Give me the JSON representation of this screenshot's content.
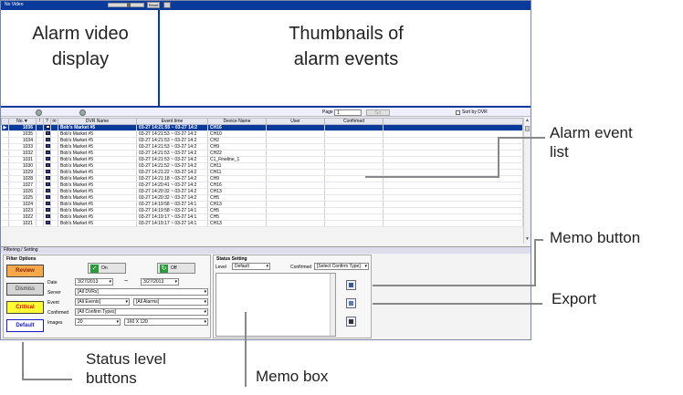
{
  "topbar": {
    "video_label": "No Video",
    "reset_label": "Reset"
  },
  "panes": {
    "video_label": [
      "Alarm video",
      "display"
    ],
    "thumb_label": [
      "Thumbnails of",
      "alarm events"
    ]
  },
  "listbar": {
    "page_label": "Page",
    "page_value": "1",
    "go_label": "Go",
    "sort_label": "Sort by DVR"
  },
  "columns": [
    "No.▼",
    "!",
    "?",
    "✉",
    "DVR Name",
    "Event time",
    "Device Name",
    "User",
    "Confirmed"
  ],
  "rows": [
    {
      "no": "1036",
      "dvr": "Bob's Market #5",
      "time": "03-27 14:21:55 ~ 03-27 14:2",
      "dev": "CH16",
      "sel": true
    },
    {
      "no": "1035",
      "dvr": "Bob's Market #5",
      "time": "03-27 14:21:53 ~ 03-27 14:2",
      "dev": "CH10"
    },
    {
      "no": "1034",
      "dvr": "Bob's Market #5",
      "time": "03-27 14:21:53 ~ 03-27 14:2",
      "dev": "CH2"
    },
    {
      "no": "1033",
      "dvr": "Bob's Market #5",
      "time": "03-27 14:21:53 ~ 03-27 14:2",
      "dev": "CH9"
    },
    {
      "no": "1032",
      "dvr": "Bob's Market #5",
      "time": "03-27 14:21:53 ~ 03-27 14:2",
      "dev": "CH22"
    },
    {
      "no": "1031",
      "dvr": "Bob's Market #5",
      "time": "03-27 14:21:53 ~ 03-27 14:2",
      "dev": "C1_Fineline_1"
    },
    {
      "no": "1030",
      "dvr": "Bob's Market #5",
      "time": "03-27 14:21:52 ~ 03-27 14:2",
      "dev": "CH11"
    },
    {
      "no": "1029",
      "dvr": "Bob's Market #5",
      "time": "03-27 14:21:22 ~ 03-27 14:2",
      "dev": "CH11"
    },
    {
      "no": "1028",
      "dvr": "Bob's Market #5",
      "time": "03-27 14:21:18 ~ 03-27 14:2",
      "dev": "CH9"
    },
    {
      "no": "1027",
      "dvr": "Bob's Market #5",
      "time": "03-27 14:20:41 ~ 03-27 14:2",
      "dev": "CH16"
    },
    {
      "no": "1026",
      "dvr": "Bob's Market #5",
      "time": "03-27 14:20:32 ~ 03-27 14:2",
      "dev": "CH13"
    },
    {
      "no": "1025",
      "dvr": "Bob's Market #5",
      "time": "03-27 14:20:32 ~ 03-27 14:2",
      "dev": "CH5"
    },
    {
      "no": "1024",
      "dvr": "Bob's Market #5",
      "time": "03-27 14:19:58 ~ 03-27 14:1",
      "dev": "CH13"
    },
    {
      "no": "1023",
      "dvr": "Bob's Market #5",
      "time": "03-27 14:19:58 ~ 03-27 14:1",
      "dev": "CH5"
    },
    {
      "no": "1022",
      "dvr": "Bob's Market #5",
      "time": "03-27 14:19:17 ~ 03-27 14:1",
      "dev": "CH5"
    },
    {
      "no": "1021",
      "dvr": "Bob's Market #5",
      "time": "03-27 14:19:17 ~ 03-27 14:1",
      "dev": "CH13"
    }
  ],
  "filter": {
    "header": "Filtering / Setting",
    "title": "Filter Options",
    "levels": {
      "review": "Review",
      "dismiss": "Dismiss",
      "critical": "Critical",
      "default": "Default"
    },
    "on_label": "On",
    "off_label": "Off",
    "date_label": "Date",
    "date_from": "3/27/2013",
    "date_sep": "~",
    "date_to": "3/27/2013",
    "server_label": "Server",
    "server_value": "[All DVRs]",
    "event_label": "Event",
    "event_value": "[All Events]",
    "event_alarm": "[All Alarms]",
    "confirmed_label": "Confirmed",
    "confirmed_value": "[All Confirm Types]",
    "images_label": "Images",
    "images_count": "20",
    "images_size": "160 X 120"
  },
  "status": {
    "title": "Status Setting",
    "level_label": "Level",
    "level_value": "Default",
    "confirmed_label": "Confirmed",
    "confirmed_value": "[Select Confirm Type]"
  },
  "callouts": {
    "alarm_list": [
      "Alarm event",
      "list"
    ],
    "memo_button": "Memo button",
    "export": "Export",
    "status_levels": [
      "Status level",
      "buttons"
    ],
    "memo_box": "Memo box"
  },
  "colors": {
    "titlebar": "#0a3a9c",
    "review": "#f7a84a",
    "critical": "#ffff33",
    "default_border": "#1a1ac0"
  }
}
